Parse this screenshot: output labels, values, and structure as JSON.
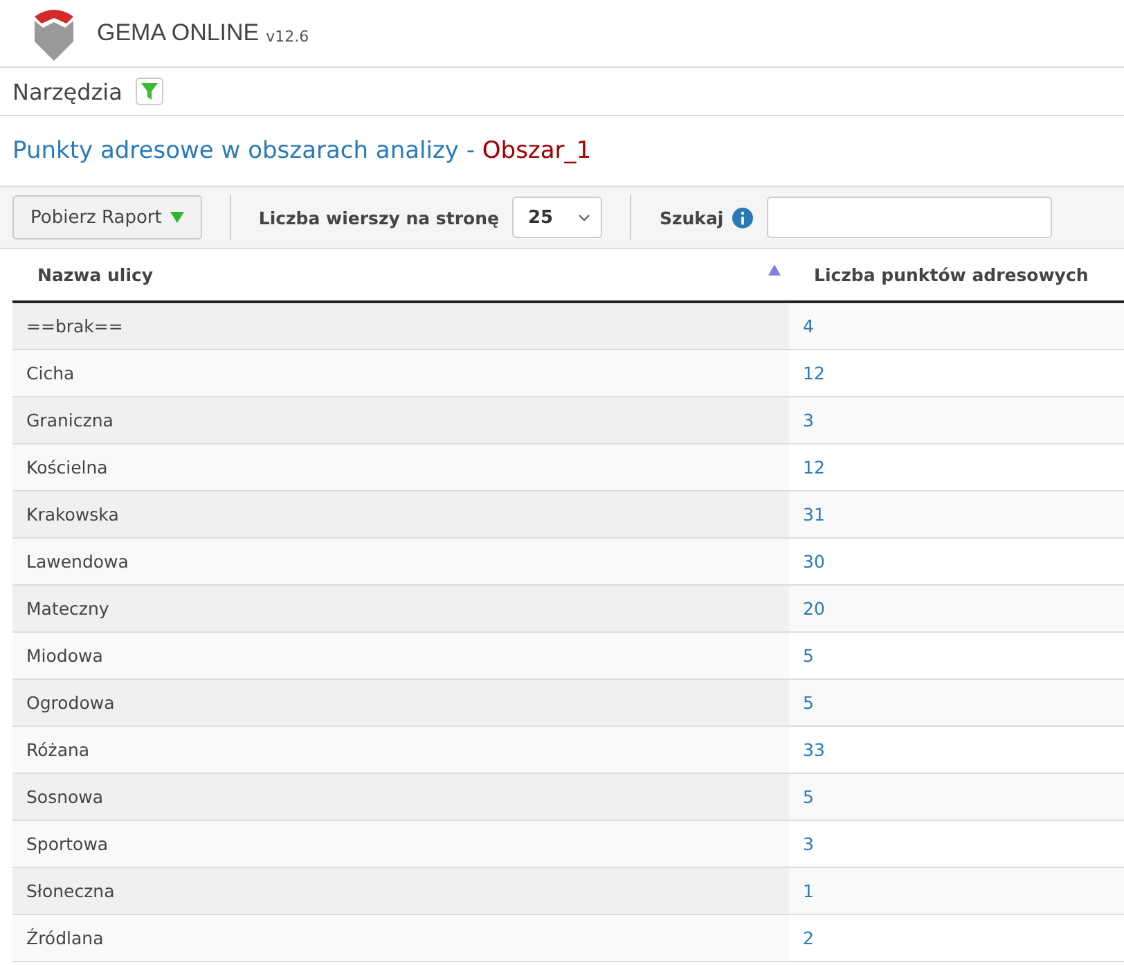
{
  "app": {
    "name": "GEMA ONLINE",
    "version": "v12.6"
  },
  "toolbar": {
    "label": "Narzędzia"
  },
  "title": {
    "text": "Punkty adresowe w obszarach analizy - ",
    "area": "Obszar_1"
  },
  "controls": {
    "report_button": "Pobierz Raport",
    "rows_label": "Liczba wierszy na stronę",
    "rows_value": "25",
    "search_label": "Szukaj"
  },
  "table": {
    "columns": [
      {
        "label": "Nazwa ulicy",
        "sorted": true
      },
      {
        "label": "Liczba punktów adresowych",
        "sorted": false
      }
    ],
    "rows": [
      {
        "street": "==brak==",
        "count": "4"
      },
      {
        "street": "Cicha",
        "count": "12"
      },
      {
        "street": "Graniczna",
        "count": "3"
      },
      {
        "street": "Kościelna",
        "count": "12"
      },
      {
        "street": "Krakowska",
        "count": "31"
      },
      {
        "street": "Lawendowa",
        "count": "30"
      },
      {
        "street": "Mateczny",
        "count": "20"
      },
      {
        "street": "Miodowa",
        "count": "5"
      },
      {
        "street": "Ogrodowa",
        "count": "5"
      },
      {
        "street": "Różana",
        "count": "33"
      },
      {
        "street": "Sosnowa",
        "count": "5"
      },
      {
        "street": "Sportowa",
        "count": "3"
      },
      {
        "street": "Słoneczna",
        "count": "1"
      },
      {
        "street": "Źródlana",
        "count": "2"
      }
    ]
  }
}
